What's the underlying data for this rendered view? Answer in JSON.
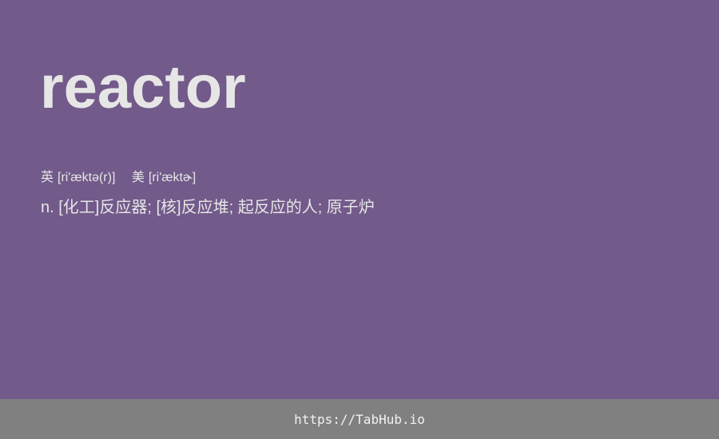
{
  "word": "reactor",
  "phonetics": {
    "uk_label": "英",
    "uk": "[ri'æktə(r)]",
    "us_label": "美",
    "us": "[ri'æktɚ]"
  },
  "definition": "n. [化工]反应器; [核]反应堆; 起反应的人; 原子炉",
  "footer": {
    "link": "https://TabHub.io"
  },
  "colors": {
    "background": "#725a8a",
    "footer_background": "#808080",
    "text": "#e6e6e6"
  }
}
